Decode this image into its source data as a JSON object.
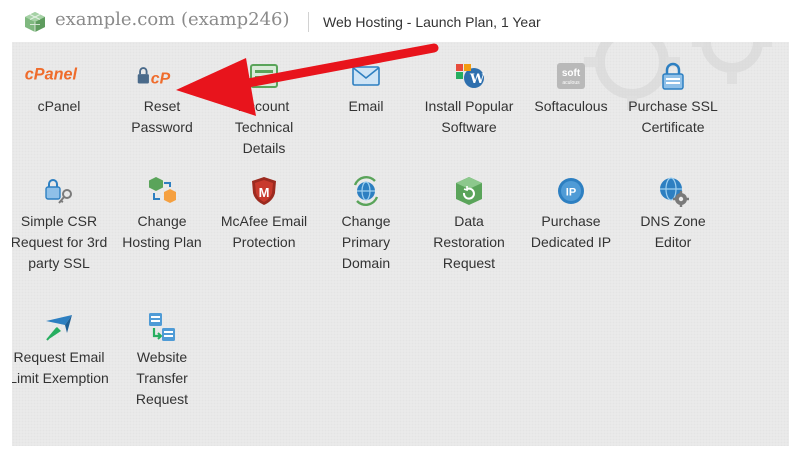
{
  "header": {
    "domain": "example.com (examp246)",
    "product": "Web Hosting - Launch Plan, 1 Year"
  },
  "icons": {
    "cpanel_logo": "cPanel",
    "cp_logo": "cP",
    "softaculous_logo_line1": "soft",
    "softaculous_logo_line2": "aculous",
    "ip_badge": "IP",
    "mcafee_letter": "M"
  },
  "tiles": [
    {
      "label": "cPanel",
      "icon": "cpanel-logo-icon"
    },
    {
      "label": "Reset Password",
      "icon": "lock-cpanel-icon"
    },
    {
      "label": "Account Technical Details",
      "icon": "account-details-icon"
    },
    {
      "label": "Email",
      "icon": "envelope-icon"
    },
    {
      "label": "Install Popular Software",
      "icon": "popular-software-icon"
    },
    {
      "label": "Softaculous",
      "icon": "softaculous-icon"
    },
    {
      "label": "Purchase SSL Certificate",
      "icon": "ssl-lock-icon"
    },
    {
      "label": "Simple CSR Request for 3rd party SSL",
      "icon": "lock-key-icon"
    },
    {
      "label": "Change Hosting Plan",
      "icon": "change-plan-icon"
    },
    {
      "label": "McAfee Email Protection",
      "icon": "mcafee-shield-icon"
    },
    {
      "label": "Change Primary Domain",
      "icon": "globe-refresh-icon"
    },
    {
      "label": "Data Restoration Request",
      "icon": "restore-box-icon"
    },
    {
      "label": "Purchase Dedicated IP",
      "icon": "ip-globe-icon"
    },
    {
      "label": "DNS Zone Editor",
      "icon": "dns-gear-icon"
    },
    {
      "label": "Request Email Limit Exemption",
      "icon": "email-limit-icon"
    },
    {
      "label": "Website Transfer Request",
      "icon": "transfer-servers-icon"
    }
  ],
  "colors": {
    "annotation_arrow": "#e8141c",
    "cpanel_orange": "#ef6c2c",
    "globe_blue": "#2d7fc1",
    "box_green": "#5aa45a"
  }
}
